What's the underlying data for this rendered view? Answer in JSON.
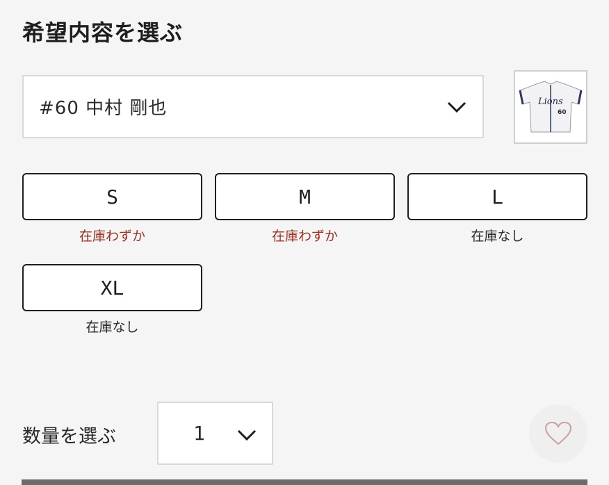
{
  "section_title": "希望内容を選ぶ",
  "player_select": {
    "selected": "#60 中村 剛也",
    "thumbnail_name": "60"
  },
  "sizes": [
    {
      "label": "S",
      "stock": "在庫わずか",
      "status": "low"
    },
    {
      "label": "M",
      "stock": "在庫わずか",
      "status": "low"
    },
    {
      "label": "L",
      "stock": "在庫なし",
      "status": "none"
    },
    {
      "label": "XL",
      "stock": "在庫なし",
      "status": "none"
    }
  ],
  "quantity": {
    "label": "数量を選ぶ",
    "value": "1"
  },
  "colors": {
    "stock_low": "#9a3322",
    "border": "#1e1e1e",
    "favorite_heart": "#c9a19a"
  },
  "icons": {
    "dropdown": "chevron-down-icon",
    "favorite": "heart-icon"
  }
}
